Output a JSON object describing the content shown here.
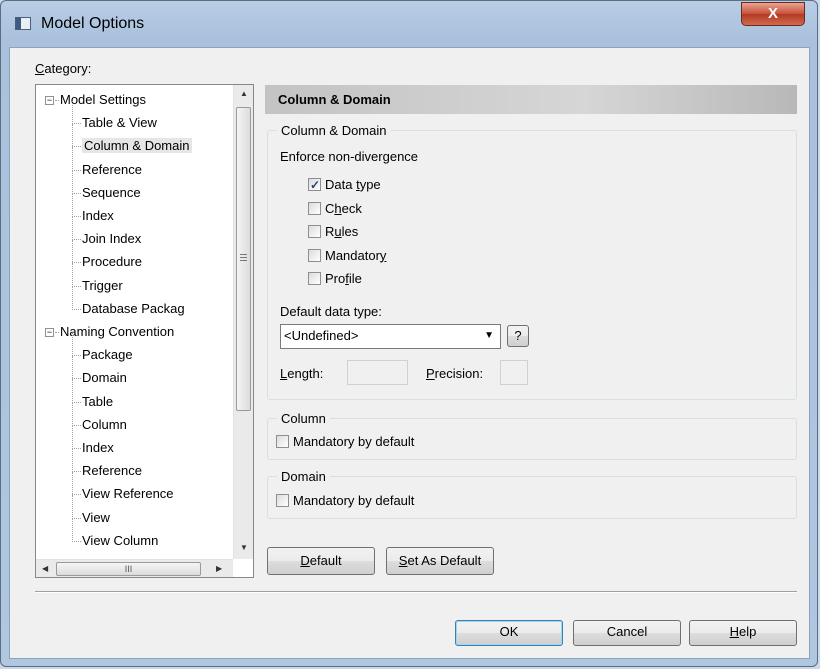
{
  "window": {
    "title": "Model Options",
    "close_glyph": "X",
    "icon": "window-app-icon"
  },
  "category": {
    "label_underlined": "C",
    "label_rest": "ategory:"
  },
  "tree": {
    "items": [
      {
        "label": "Model Settings",
        "level": 0,
        "expander": "−"
      },
      {
        "label": "Table & View",
        "level": 1
      },
      {
        "label": "Column & Domain",
        "level": 1,
        "selected": true
      },
      {
        "label": "Reference",
        "level": 1
      },
      {
        "label": "Sequence",
        "level": 1
      },
      {
        "label": "Index",
        "level": 1
      },
      {
        "label": "Join Index",
        "level": 1
      },
      {
        "label": "Procedure",
        "level": 1
      },
      {
        "label": "Trigger",
        "level": 1
      },
      {
        "label": "Database Packag",
        "level": 1
      },
      {
        "label": "Naming Convention",
        "level": 0,
        "expander": "−"
      },
      {
        "label": "Package",
        "level": 1
      },
      {
        "label": "Domain",
        "level": 1
      },
      {
        "label": "Table",
        "level": 1
      },
      {
        "label": "Column",
        "level": 1
      },
      {
        "label": "Index",
        "level": 1
      },
      {
        "label": "Reference",
        "level": 1
      },
      {
        "label": "View Reference",
        "level": 1
      },
      {
        "label": "View",
        "level": 1
      },
      {
        "label": "View Column",
        "level": 1
      }
    ],
    "scroll_up": "▲",
    "scroll_down": "▼",
    "scroll_left": "◀",
    "scroll_right": "▶",
    "hthumb_grip": "III"
  },
  "panel": {
    "header": "Column & Domain",
    "cd_group": {
      "title": "Column & Domain",
      "enforce_label": "Enforce non-divergence",
      "checkboxes": [
        {
          "pre": "Data ",
          "u": "t",
          "post": "ype",
          "checked": true
        },
        {
          "pre": "C",
          "u": "h",
          "post": "eck",
          "checked": false
        },
        {
          "pre": "R",
          "u": "u",
          "post": "les",
          "checked": false
        },
        {
          "pre": "Mandator",
          "u": "y",
          "post": "",
          "checked": false
        },
        {
          "pre": "Pro",
          "u": "f",
          "post": "ile",
          "checked": false
        }
      ],
      "default_type_label": "Default data type:",
      "default_type_value": "<Undefined>",
      "help_glyph": "?",
      "length_pre": "",
      "length_u": "L",
      "length_post": "ength:",
      "precision_u": "P",
      "precision_post": "recision:"
    },
    "column_group": {
      "title": "Column",
      "checkbox_label": "Mandatory by default",
      "checked": false
    },
    "domain_group": {
      "title": "Domain",
      "checkbox_label": "Mandatory by default",
      "checked": false
    },
    "default_btn": {
      "u": "D",
      "rest": "efault"
    },
    "set_default_btn": {
      "u": "S",
      "rest": "et As Default"
    }
  },
  "buttons": {
    "ok": "OK",
    "cancel": "Cancel",
    "help_u": "H",
    "help_rest": "elp"
  },
  "colors": {
    "close_button": "#c7503a",
    "header_bar": "#c3c3c3",
    "selection": "#e6e6e6"
  }
}
